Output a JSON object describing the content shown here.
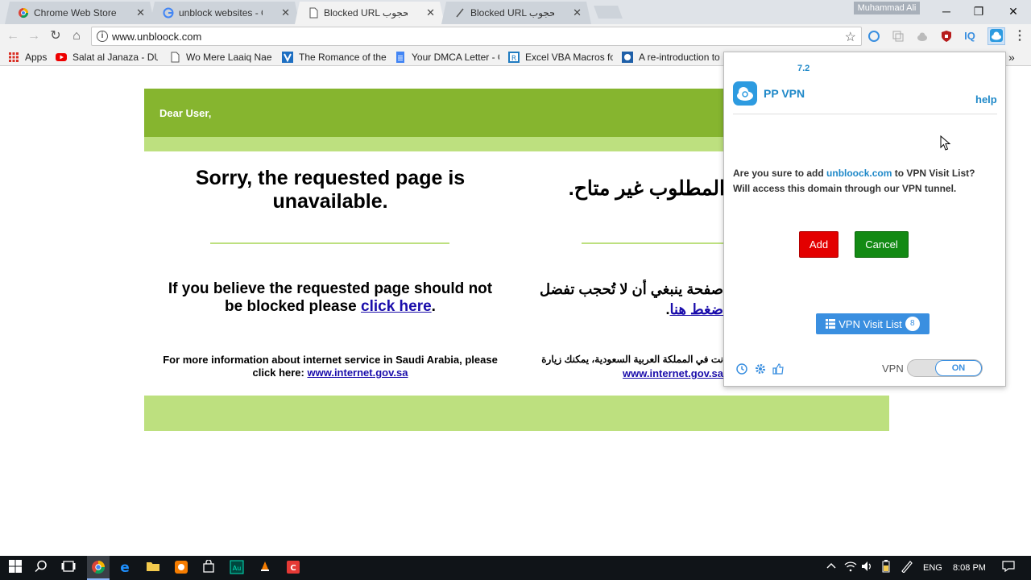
{
  "tabs": [
    {
      "title": "Chrome Web Store - pp",
      "icon": "chrome-store-icon",
      "active": false
    },
    {
      "title": "unblock websites - Goog",
      "icon": "google-icon",
      "active": false
    },
    {
      "title": "Blocked URL عنوان محجوب",
      "icon": "document-icon",
      "active": true
    },
    {
      "title": "Blocked URL عنوان محجوب",
      "icon": "loading-icon",
      "active": false
    }
  ],
  "tab_close": "✕",
  "profile_name": "Muhammad Ali",
  "window_controls": {
    "minimize": "─",
    "restore": "❐",
    "close": "✕"
  },
  "toolbar": {
    "back": "←",
    "forward": "→",
    "reload": "↻",
    "home": "⌂",
    "url": "www.unbloock.com",
    "info": "i",
    "star": "☆",
    "menu": "⋮",
    "iq_label": "IQ"
  },
  "bookmarks": [
    {
      "label": "Apps",
      "icon": "apps-grid-icon"
    },
    {
      "label": "Salat al Janaza - DUA",
      "icon": "youtube-icon"
    },
    {
      "label": "Wo Mere Laaiq Nae -",
      "icon": "page-icon"
    },
    {
      "label": "The Romance of the",
      "icon": "v-icon"
    },
    {
      "label": "Your DMCA Letter - G",
      "icon": "google-docs-icon"
    },
    {
      "label": "Excel VBA Macros for",
      "icon": "excel-icon"
    },
    {
      "label": "A re-introduction to",
      "icon": "mdn-icon"
    }
  ],
  "bookmarks_more": "»",
  "page": {
    "greeting": "Dear User,",
    "sorry_en": "Sorry, the requested page is unavailable.",
    "sorry_ar": "المطلوب غير متاح.",
    "believe_en_prefix": "If you believe the requested page should not be blocked please ",
    "believe_en_link": "click here",
    "believe_en_suffix": ".",
    "believe_ar_line": "صفحة ينبغي أن لا تُحجب تفضل",
    "believe_ar_link": "ضغط هنا",
    "believe_ar_suffix": ".",
    "info_en_prefix": "For more information about internet service in Saudi Arabia, please click here: ",
    "info_en_link": "www.internet.gov.sa",
    "info_ar_line": "نت في المملكة العربية السعودية، يمكنك زيارة",
    "info_ar_link": "www.internet.gov.sa"
  },
  "popup": {
    "version": "7.2",
    "app_name": "PP VPN",
    "help": "help",
    "confirm_prefix": "Are you sure to add ",
    "confirm_domain": "unbloock.com",
    "confirm_suffix": " to VPN Visit List? Will access this domain through our VPN tunnel.",
    "add_label": "Add",
    "cancel_label": "Cancel",
    "visit_list_label": "VPN Visit List",
    "visit_list_count": "8",
    "vpn_label": "VPN",
    "vpn_state": "ON",
    "accent": "#1e88c8",
    "add_color": "#e30000",
    "cancel_color": "#138a14"
  },
  "taskbar": {
    "language": "ENG",
    "time": "8:08 PM"
  }
}
